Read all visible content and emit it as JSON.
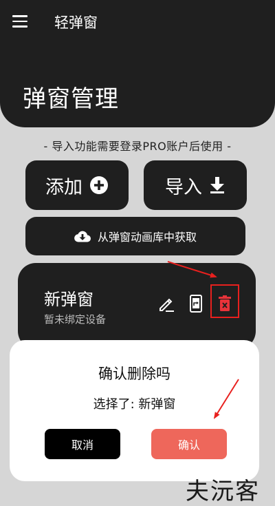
{
  "app": {
    "title": "轻弹窗",
    "menu_icon": "hamburger-menu-icon"
  },
  "page": {
    "title": "弹窗管理"
  },
  "notice": "- 导入功能需要登录PRO账户后使用 -",
  "actions": {
    "add_label": "添加",
    "import_label": "导入",
    "library_label": "从弹窗动画库中获取"
  },
  "card": {
    "title": "新弹窗",
    "subtitle": "暂未绑定设备",
    "icons": [
      "edit-icon",
      "phone-share-icon",
      "delete-icon"
    ]
  },
  "dialog": {
    "title": "确认删除吗",
    "message": "选择了: 新弹窗",
    "cancel_label": "取消",
    "confirm_label": "确认"
  },
  "watermark": "夫沅客",
  "colors": {
    "dark": "#1f1f1f",
    "background": "#d6d6d6",
    "confirm": "#ee675b",
    "delete_icon": "#e8333a",
    "annotation": "#e8201e"
  }
}
